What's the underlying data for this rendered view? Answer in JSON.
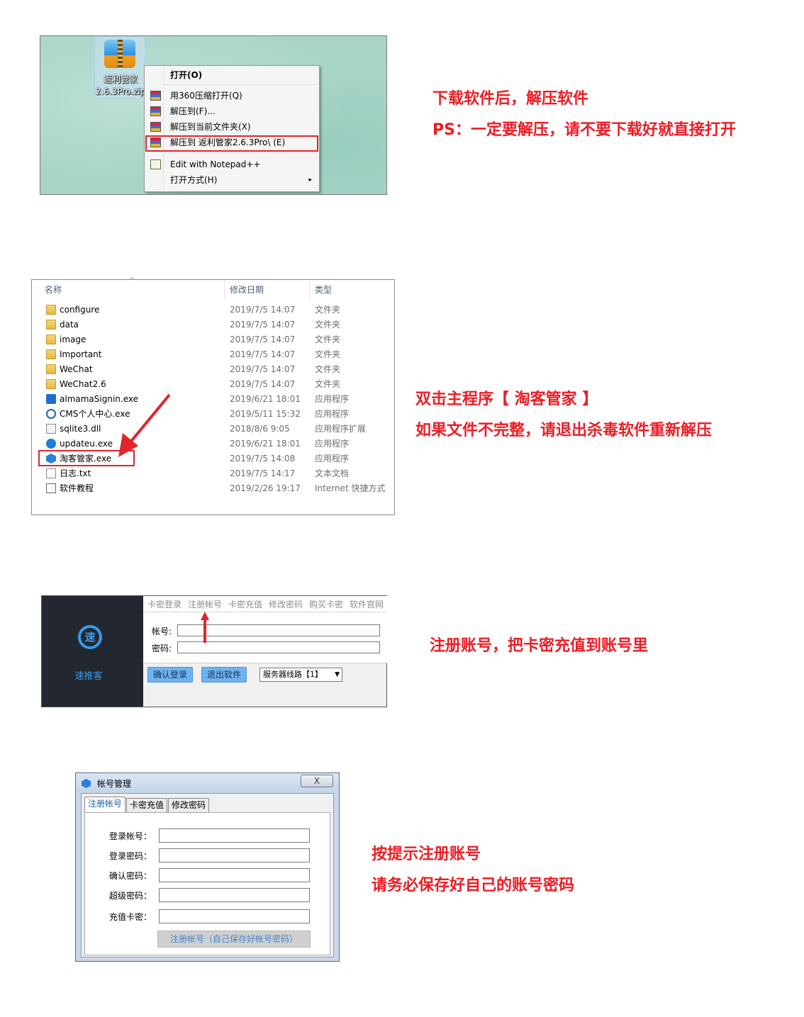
{
  "step1": {
    "desktop_icon": {
      "label_line1": "返利管家",
      "label_line2": "2.6.3Pro.zip",
      "icon": "zip-archive-icon"
    },
    "context_menu": {
      "open": "打开(O)",
      "open_360": "用360压缩打开(Q)",
      "extract_to": "解压到(F)...",
      "extract_here": "解压到当前文件夹(X)",
      "extract_folder": "解压到 返利管家2.6.3Pro\\ (E)",
      "edit_notepad": "Edit with Notepad++",
      "open_with": "打开方式(H)",
      "submenu_arrow": "▸"
    },
    "caption_line1": "下载软件后，解压软件",
    "caption_line2": "PS：一定要解压，请不要下载好就直接打开"
  },
  "step2": {
    "columns": {
      "name": "名称",
      "date": "修改日期",
      "type": "类型"
    },
    "files": [
      {
        "name": "configure",
        "date": "2019/7/5 14:07",
        "type": "文件夹",
        "icon": "folder-icon"
      },
      {
        "name": "data",
        "date": "2019/7/5 14:07",
        "type": "文件夹",
        "icon": "folder-icon"
      },
      {
        "name": "image",
        "date": "2019/7/5 14:07",
        "type": "文件夹",
        "icon": "folder-icon"
      },
      {
        "name": "Important",
        "date": "2019/7/5 14:07",
        "type": "文件夹",
        "icon": "folder-icon"
      },
      {
        "name": "WeChat",
        "date": "2019/7/5 14:07",
        "type": "文件夹",
        "icon": "folder-icon"
      },
      {
        "name": "WeChat2.6",
        "date": "2019/7/5 14:07",
        "type": "文件夹",
        "icon": "folder-icon"
      },
      {
        "name": "almamaSignin.exe",
        "date": "2019/6/21 18:01",
        "type": "应用程序",
        "icon": "app-icon"
      },
      {
        "name": "CMS个人中心.exe",
        "date": "2019/5/11 15:32",
        "type": "应用程序",
        "icon": "app-icon"
      },
      {
        "name": "sqlite3.dll",
        "date": "2018/8/6 9:05",
        "type": "应用程序扩展",
        "icon": "dll-icon"
      },
      {
        "name": "updateu.exe",
        "date": "2019/6/21 18:01",
        "type": "应用程序",
        "icon": "update-icon"
      },
      {
        "name": "淘客管家.exe",
        "date": "2019/7/5 14:08",
        "type": "应用程序",
        "icon": "app-icon"
      },
      {
        "name": "日志.txt",
        "date": "2019/7/5 14:17",
        "type": "文本文档",
        "icon": "text-file-icon"
      },
      {
        "name": "软件教程",
        "date": "2019/2/26 19:17",
        "type": "Internet 快捷方式",
        "icon": "shortcut-icon"
      }
    ],
    "caption_line1": "双击主程序【 淘客管家 】",
    "caption_line2": "如果文件不完整，请退出杀毒软件重新解压"
  },
  "step3": {
    "logo_char": "速",
    "brand": "速推客",
    "tabs": [
      "卡密登录",
      "注册帐号",
      "卡密充值",
      "修改密码",
      "购买卡密",
      "软件官网"
    ],
    "account_label": "帐号:",
    "password_label": "密码:",
    "login_button": "确认登录",
    "exit_button": "退出软件",
    "server_select": "服务器线路【1】",
    "caption": "注册账号，把卡密充值到账号里"
  },
  "step4": {
    "title": "帐号管理",
    "close": "X",
    "tabs": [
      "注册帐号",
      "卡密充值",
      "修改密码"
    ],
    "fields": [
      "登录帐号：",
      "登录密码：",
      "确认密码：",
      "超级密码：",
      "充值卡密："
    ],
    "register_button": "注册帐号（自己保存好帐号密码）",
    "caption_line1": "按提示注册账号",
    "caption_line2": "请务必保存好自己的账号密码"
  }
}
